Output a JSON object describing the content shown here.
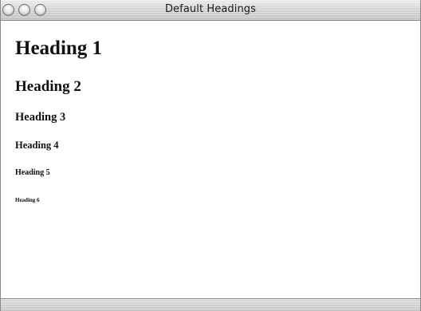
{
  "window": {
    "title": "Default Headings",
    "controls": [
      "close-icon",
      "minimize-icon",
      "zoom-icon"
    ]
  },
  "content": {
    "headings": [
      "Heading 1",
      "Heading 2",
      "Heading 3",
      "Heading 4",
      "Heading 5",
      "Heading 6"
    ]
  },
  "colors": {
    "text": "#111111",
    "background": "#ffffff",
    "titlebar": "#d4d4d4"
  }
}
